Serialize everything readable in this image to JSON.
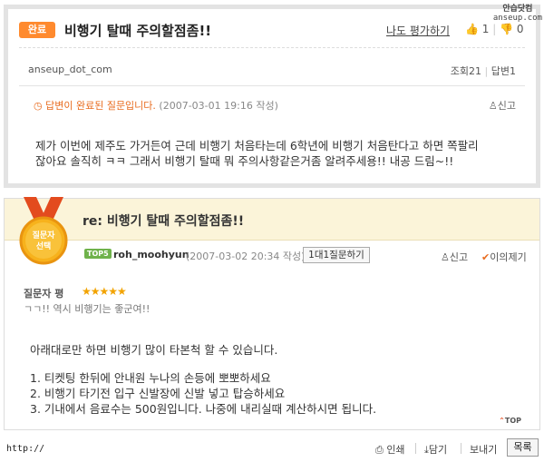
{
  "site_logo": {
    "line1": "안습닷컴",
    "line2": "anseup.com"
  },
  "question": {
    "badge": "완료",
    "title": "비행기 탈때 주의할점좀!!",
    "rate_link": "나도 평가하기",
    "upvotes": "1",
    "downvotes": "0",
    "author": "anseup_dot_com",
    "views": "조회21",
    "answers": "답변1",
    "status": "답변이 완료된 질문입니다.",
    "date": "(2007-03-01 19:16 작성)",
    "report": "신고",
    "body_line1": "제가 이번에 제주도 가거든여 근데 비행기 처음타는데 6학년에 비행기 처음탄다고 하면 쪽팔리",
    "body_line2": "잖아요 솔직히 ㅋㅋ 그래서 비행기 탈때 뭐 주의사항같은거좀 알려주세용!! 내공 드림~!!"
  },
  "answer": {
    "medal_line1": "질문자",
    "medal_line2": "선택",
    "title": "re: 비행기 탈때 주의할점좀!!",
    "rank_badge": "TOP5",
    "author": "roh_moohyun",
    "date": "(2007-03-02 20:34 작성)",
    "one_on_one": "1대1질문하기",
    "report": "신고",
    "objection": "이의제기",
    "rating_label": "질문자 평",
    "stars": "★★★★★",
    "rating_comment": "ㄱㄱ!! 역시 비행기는 좋군여!!",
    "intro": "아래대로만 하면 비행기 많이 타본척 할 수 있습니다.",
    "line1": "1. 티켓팅 한뒤에 안내원 누나의 손등에 뽀뽀하세요",
    "line2": "2. 비행기 타기전 입구 신발장에 신발 넣고 탑승하세요",
    "line3": "3. 기내에서 음료수는 500원입니다. 나중에 내리실때 계산하시면 됩니다.",
    "top": "TOP"
  },
  "footer": {
    "url": "http://",
    "print": "인쇄",
    "save": "담기",
    "send": "보내기",
    "list": "목록"
  },
  "colors": {
    "accent": "#ff8a2e",
    "answer_header_bg": "#fbf4d9",
    "star": "#f2a300"
  }
}
